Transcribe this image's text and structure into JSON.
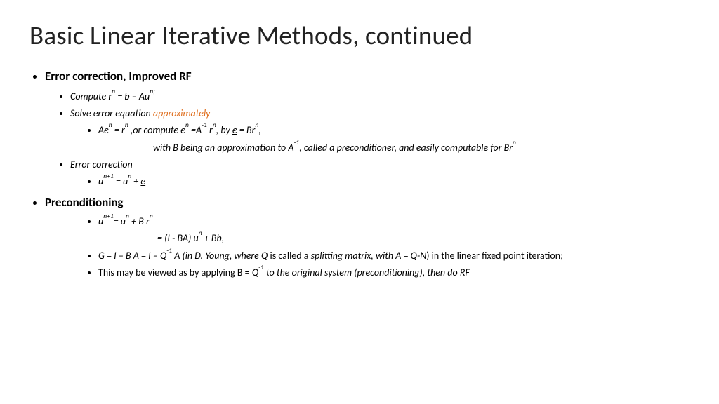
{
  "title": "Basic Linear Iterative Methods, continued",
  "sec1": {
    "head": "Error correction, Improved RF",
    "compute_pre": "Compute r",
    "compute_sup": "n",
    "compute_post": " = b – Au",
    "compute_sup2": "n;",
    "solve_pre": "Solve error equation ",
    "solve_em": "approximately",
    "ae_1": "Ae",
    "ae_s1": "n",
    "ae_2": " = r",
    "ae_s2": "n",
    "ae_3": " ,or  compute e",
    "ae_s3": "n",
    "ae_4": " =A",
    "ae_s4": "-1",
    "ae_5": " r",
    "ae_s5": "n",
    "ae_6": ", by ",
    "ae_u": "e",
    "ae_7": " = Br",
    "ae_s6": "n",
    "ae_8": ",",
    "withB_1": "with B being an approximation to A",
    "withB_s1": "-1",
    "withB_2": ", called a ",
    "withB_u": "preconditioner",
    "withB_3": ", and easily computable for Br",
    "withB_s2": "n",
    "errcorr": "Error correction",
    "upd_1": "u",
    "upd_s1": "n+1",
    "upd_2": " = u",
    "upd_s2": "n",
    "upd_3": " + ",
    "upd_u": "e"
  },
  "sec2": {
    "head": "Preconditioning",
    "p1_1": "u",
    "p1_s1": "n+1",
    "p1_2": "= u",
    "p1_s2": "n",
    "p1_3": " + B r",
    "p1_s3": "n",
    "p2_1": "= (I - BA) u",
    "p2_s1": "n",
    "p2_2": " + Bb,",
    "g_1": "G = I – B A = I – Q",
    "g_s1": "-1",
    "g_2": " A (in D. Young, where Q ",
    "g_3": "is called a ",
    "g_4": "splitting matrix, with A = Q-N",
    "g_5": ")  in  the linear fixed point iteration;",
    "last_1": "This may be viewed as by applying B = ",
    "last_2": "Q",
    "last_s1": "-1",
    "last_3": " to the original system (preconditioning), then do RF"
  }
}
